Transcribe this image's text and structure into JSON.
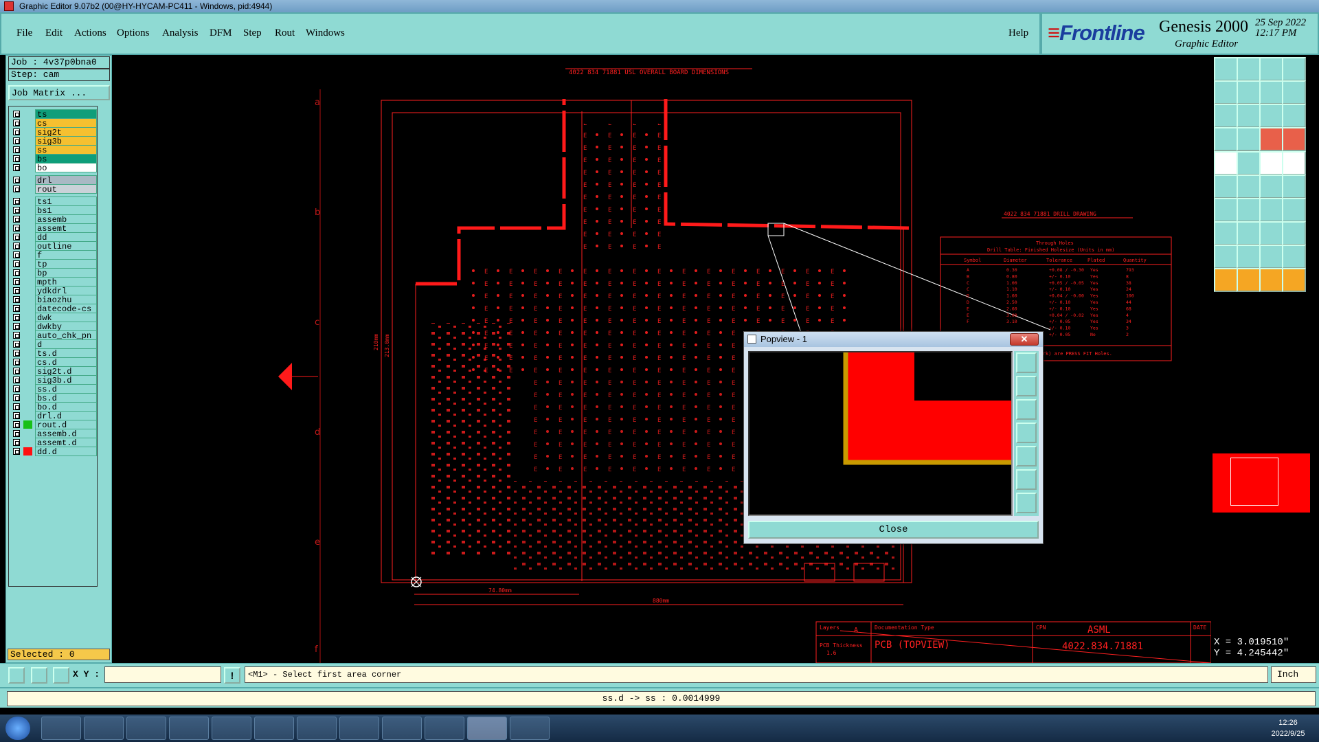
{
  "window": {
    "title": "Graphic Editor 9.07b2 (00@HY-HYCAM-PC411 - Windows, pid:4944)"
  },
  "menu": {
    "items": [
      "File",
      "Edit",
      "Actions",
      "Options",
      "Analysis",
      "DFM",
      "Step",
      "Rout",
      "Windows"
    ],
    "help": "Help"
  },
  "brand": {
    "logo": "Frontline",
    "product": "Genesis 2000",
    "subtitle": "Graphic Editor",
    "date": "25 Sep 2022",
    "time": "12:17 PM"
  },
  "job": {
    "job_label": "Job : 4v37p0bna0",
    "step_label": "Step: cam",
    "matrix_button": "Job Matrix ..."
  },
  "layers": [
    {
      "name": "ts",
      "color": "#0f9e7a"
    },
    {
      "name": "cs",
      "color": "#f5c030"
    },
    {
      "name": "sig2t",
      "color": "#f5c030"
    },
    {
      "name": "sig3b",
      "color": "#f5c030"
    },
    {
      "name": "ss",
      "color": "#f5c030"
    },
    {
      "name": "bs",
      "color": "#0f9e7a"
    },
    {
      "name": "bo",
      "color": "#ffffff"
    },
    {
      "name": "drl",
      "color": "#a9b9c4"
    },
    {
      "name": "rout",
      "color": "#c9d2d8"
    },
    {
      "name": "ts1",
      "color": "#8fdad3"
    },
    {
      "name": "bs1",
      "color": "#8fdad3"
    },
    {
      "name": "assemb",
      "color": "#8fdad3"
    },
    {
      "name": "assemt",
      "color": "#8fdad3"
    },
    {
      "name": "dd",
      "color": "#8fdad3"
    },
    {
      "name": "outline",
      "color": "#8fdad3"
    },
    {
      "name": "f",
      "color": "#8fdad3"
    },
    {
      "name": "tp",
      "color": "#8fdad3"
    },
    {
      "name": "bp",
      "color": "#8fdad3"
    },
    {
      "name": "mpth",
      "color": "#8fdad3"
    },
    {
      "name": "ydkdrl",
      "color": "#8fdad3"
    },
    {
      "name": "biaozhu",
      "color": "#8fdad3"
    },
    {
      "name": "datecode-cs",
      "color": "#8fdad3"
    },
    {
      "name": "dwk",
      "color": "#8fdad3"
    },
    {
      "name": "dwkby",
      "color": "#8fdad3"
    },
    {
      "name": "auto_chk_pn",
      "color": "#8fdad3"
    },
    {
      "name": "d",
      "color": "#8fdad3"
    },
    {
      "name": "ts.d",
      "color": "#8fdad3"
    },
    {
      "name": "cs.d",
      "color": "#8fdad3"
    },
    {
      "name": "sig2t.d",
      "color": "#8fdad3"
    },
    {
      "name": "sig3b.d",
      "color": "#8fdad3"
    },
    {
      "name": "ss.d",
      "color": "#8fdad3"
    },
    {
      "name": "bs.d",
      "color": "#8fdad3"
    },
    {
      "name": "bo.d",
      "color": "#8fdad3"
    },
    {
      "name": "drl.d",
      "color": "#8fdad3"
    },
    {
      "name": "rout.d",
      "color": "#8fdad3"
    },
    {
      "name": "assemb.d",
      "color": "#8fdad3"
    },
    {
      "name": "assemt.d",
      "color": "#8fdad3"
    },
    {
      "name": "dd.d",
      "color": "#8fdad3"
    }
  ],
  "selected": "Selected : 0",
  "canvas": {
    "title_text": "4022 834 71881 USL OVERALL BOARD DIMENSIONS",
    "drill_title": "4022 834 71881 DRILL DRAWING",
    "row_labels": [
      "a",
      "b",
      "c",
      "d",
      "e",
      "f"
    ],
    "dim_bottom": "74.80mm",
    "dim_bottom2": "880mm",
    "dim_left": "210mm",
    "dim_left2": "213.0mm",
    "drill_table": {
      "heading": "Through Holes",
      "subheading": "Drill Table: Finished Holesize (Units in mm)",
      "columns": [
        "Symbol",
        "Diameter",
        "Tolerance",
        "Plated",
        "Quantity"
      ],
      "note": "(Insertion work) are PRESS FIT Holes.",
      "rows": [
        [
          "A",
          "0.30",
          "+0.08 / -0.30",
          "Yes",
          "793"
        ],
        [
          "B",
          "0.80",
          "+/- 0.10",
          "Yes",
          "8"
        ],
        [
          "C",
          "1.00",
          "+0.05 / -0.05",
          "Yes",
          "38"
        ],
        [
          "C",
          "1.10",
          "+/- 0.10",
          "Yes",
          "24"
        ],
        [
          "D",
          "1.60",
          "+0.04 / -0.00",
          "Yes",
          "100"
        ],
        [
          "D",
          "2.50",
          "+/- 0.10",
          "Yes",
          "44"
        ],
        [
          "E",
          "2.60",
          "+/- 0.10",
          "Yes",
          "68"
        ],
        [
          "E",
          "3.00",
          "+0.04 / -0.02",
          "Yes",
          "4"
        ],
        [
          "F",
          "3.10",
          "+/- 0.05",
          "Yes",
          "34"
        ],
        [
          "",
          "",
          "+/- 0.10",
          "Yes",
          "3"
        ],
        [
          "",
          "",
          "+/- 0.05",
          "No",
          "2"
        ]
      ]
    },
    "title_block": {
      "layers_label": "Layers",
      "layers_value": "A",
      "doc_type_label": "Documentation Type",
      "doc_type_value": "PCB (TOPVIEW)",
      "cpn_label": "CPN",
      "cpn_value": "ASML",
      "pn_value": "4022.834.71881",
      "date_label": "DATE",
      "thickness_label": "PCB Thickness",
      "thickness_value": "1.6"
    }
  },
  "popview": {
    "title": "Popview - 1",
    "close_button": "Close"
  },
  "coords": {
    "x": "X = 3.019510\"",
    "y": "Y = 4.245442\""
  },
  "command": {
    "xy_label": "X Y :",
    "xy_value": "",
    "prompt": "<M1> - Select first area corner",
    "unit": "Inch"
  },
  "status": "ss.d -> ss : 0.0014999",
  "taskbar": {
    "time": "12:26",
    "date": "2022/9/25"
  },
  "colors": {
    "accent_bg": "#8fdad3",
    "board_red": "#ff1a1a",
    "selected_bg": "#f5c84a"
  }
}
